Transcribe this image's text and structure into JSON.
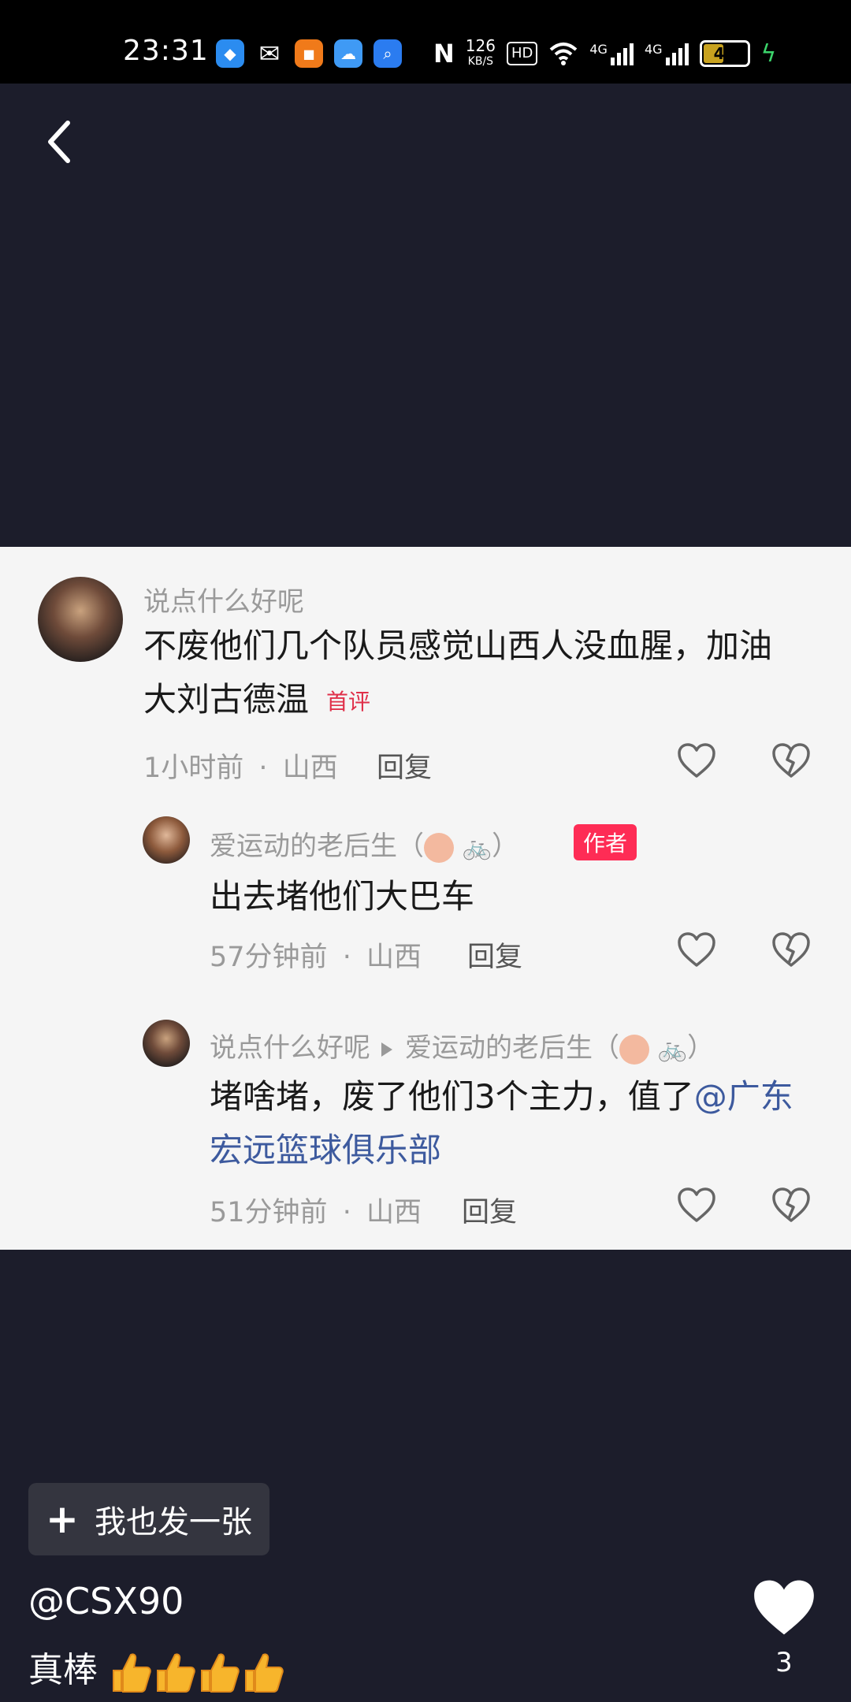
{
  "status_bar": {
    "time": "23:31",
    "net_speed_value": "126",
    "net_speed_unit": "KB/S",
    "hd_label": "HD",
    "sim1_label": "4G",
    "sim2_label": "4G",
    "battery": "46"
  },
  "comments": [
    {
      "user": "说点什么好呢",
      "text": "不废他们几个队员感觉山西人没血腥，加油大刘古德温",
      "tag": "首评",
      "time": "1小时前",
      "location": "山西",
      "reply_label": "回复"
    },
    {
      "user": "爱运动的老后生（",
      "user_suffix": "）",
      "tag": "作者",
      "text": "出去堵他们大巴车",
      "time": "57分钟前",
      "location": "山西",
      "reply_label": "回复"
    },
    {
      "user": "说点什么好呢",
      "reply_to": "爱运动的老后生（",
      "reply_to_suffix": "）",
      "text_prefix": "堵啥堵，废了他们3个主力，值了",
      "mention": "@广东宏远篮球俱乐部",
      "time": "51分钟前",
      "location": "山西",
      "reply_label": "回复"
    }
  ],
  "meta_separator": "·",
  "post_button": {
    "label": "我也发一张"
  },
  "author_handle": "@CSX90",
  "caption": "真棒",
  "like_count": "3"
}
